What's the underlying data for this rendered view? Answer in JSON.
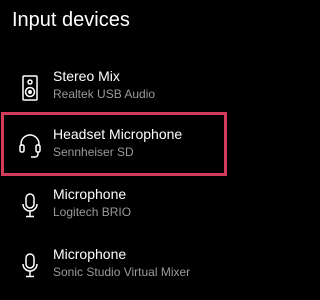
{
  "header": {
    "title": "Input devices"
  },
  "devices": [
    {
      "name": "Stereo Mix",
      "subtitle": "Realtek USB Audio",
      "icon": "speaker-icon"
    },
    {
      "name": "Headset Microphone",
      "subtitle": "Sennheiser SD",
      "icon": "headset-icon"
    },
    {
      "name": "Microphone",
      "subtitle": "Logitech BRIO",
      "icon": "microphone-icon"
    },
    {
      "name": "Microphone",
      "subtitle": "Sonic Studio Virtual Mixer",
      "icon": "microphone-icon"
    }
  ],
  "selection": {
    "index": 1,
    "color": "#d33b5a"
  },
  "colors": {
    "background": "#000000",
    "text": "#ffffff",
    "subtext": "#9a9a9a"
  }
}
